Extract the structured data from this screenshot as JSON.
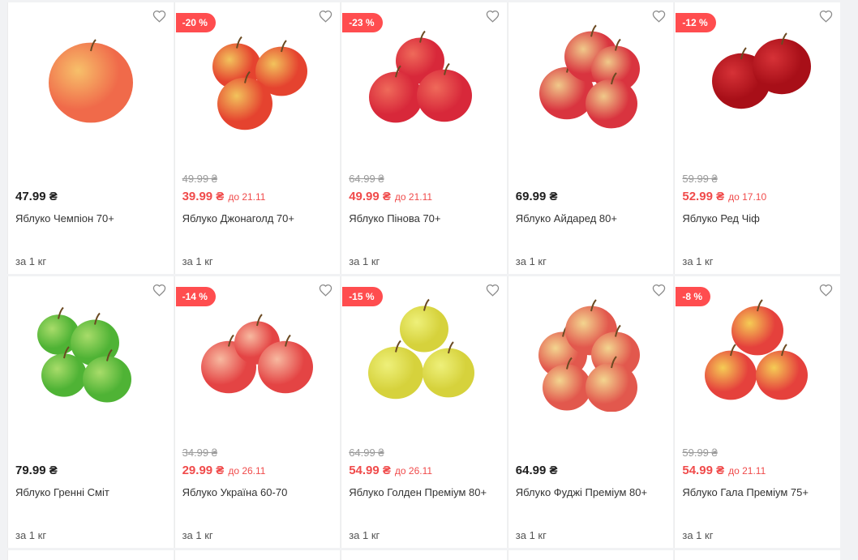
{
  "products": [
    {
      "name": "Яблуко Чемпіон 70+",
      "price": "47.99 ₴",
      "old_price": "",
      "discount": "",
      "until": "",
      "unit": "за 1 кг",
      "colors": {
        "main": "#f06a4a",
        "light": "#f7c06a"
      }
    },
    {
      "name": "Яблуко Джонаголд 70+",
      "price": "39.99 ₴",
      "old_price": "49.99 ₴",
      "discount": "-20 %",
      "until": "до 21.11",
      "unit": "за 1 кг",
      "colors": {
        "main": "#e5432f",
        "light": "#f2c35c"
      }
    },
    {
      "name": "Яблуко Пінова 70+",
      "price": "49.99 ₴",
      "old_price": "64.99 ₴",
      "discount": "-23 %",
      "until": "до 21.11",
      "unit": "за 1 кг",
      "colors": {
        "main": "#d8283a",
        "light": "#ef6a5a"
      }
    },
    {
      "name": "Яблуко Айдаред 80+",
      "price": "69.99 ₴",
      "old_price": "",
      "discount": "",
      "until": "",
      "unit": "за 1 кг",
      "colors": {
        "main": "#d9343f",
        "light": "#f0c98a"
      }
    },
    {
      "name": "Яблуко Ред Чіф",
      "price": "52.99 ₴",
      "old_price": "59.99 ₴",
      "discount": "-12 %",
      "until": "до 17.10",
      "unit": "за 1 кг",
      "colors": {
        "main": "#a80f18",
        "light": "#d63237"
      }
    },
    {
      "name": "Яблуко Гренні Сміт",
      "price": "79.99 ₴",
      "old_price": "",
      "discount": "",
      "until": "",
      "unit": "за 1 кг",
      "colors": {
        "main": "#4fb335",
        "light": "#a8dc6a"
      }
    },
    {
      "name": "Яблуко Україна 60-70",
      "price": "29.99 ₴",
      "old_price": "34.99 ₴",
      "discount": "-14 %",
      "until": "до 26.11",
      "unit": "за 1 кг",
      "colors": {
        "main": "#e44444",
        "light": "#f7b9a0"
      }
    },
    {
      "name": "Яблуко Голден Преміум 80+",
      "price": "54.99 ₴",
      "old_price": "64.99 ₴",
      "discount": "-15 %",
      "until": "до 26.11",
      "unit": "за 1 кг",
      "colors": {
        "main": "#d6d23c",
        "light": "#eef07a"
      }
    },
    {
      "name": "Яблуко Фуджі Преміум 80+",
      "price": "64.99 ₴",
      "old_price": "",
      "discount": "",
      "until": "",
      "unit": "за 1 кг",
      "colors": {
        "main": "#e2584d",
        "light": "#f3d58f"
      }
    },
    {
      "name": "Яблуко Гала Преміум 75+",
      "price": "54.99 ₴",
      "old_price": "59.99 ₴",
      "discount": "-8 %",
      "until": "до 21.11",
      "unit": "за 1 кг",
      "colors": {
        "main": "#e5413c",
        "light": "#f5cc55"
      }
    }
  ]
}
